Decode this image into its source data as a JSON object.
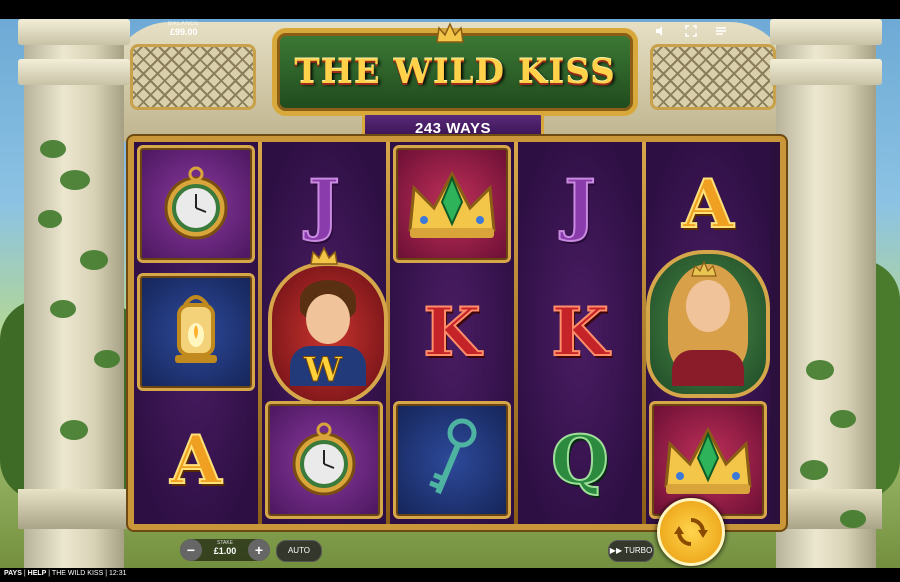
{
  "game": {
    "title": "THE WILD KISS",
    "ways": "243 WAYS"
  },
  "hud": {
    "balance_label": "BALANCE",
    "balance_value": "£99.00",
    "icons": [
      "speaker-icon",
      "fullscreen-icon",
      "menu-icon"
    ]
  },
  "reels": [
    [
      "clock",
      "lantern",
      "A"
    ],
    [
      "J",
      "prince-wild",
      "clock"
    ],
    [
      "crown",
      "K",
      "key"
    ],
    [
      "J",
      "K",
      "Q"
    ],
    [
      "A",
      "princess",
      "crown"
    ]
  ],
  "wild_label": "W",
  "controls": {
    "minus": "−",
    "plus": "+",
    "stake_label": "STAKE",
    "stake_value": "£1.00",
    "auto_label": "AUTO",
    "turbo_label": "TURBO"
  },
  "footer": {
    "pays": "PAYS",
    "help": "HELP",
    "game_name": "THE WILD KISS",
    "time": "12:31",
    "sep": "|"
  },
  "colors": {
    "frame_gold": "#c9973a",
    "reel_bg": "#2e0f44",
    "title_green": "#3d7a35",
    "spin_orange": "#f0a814"
  }
}
